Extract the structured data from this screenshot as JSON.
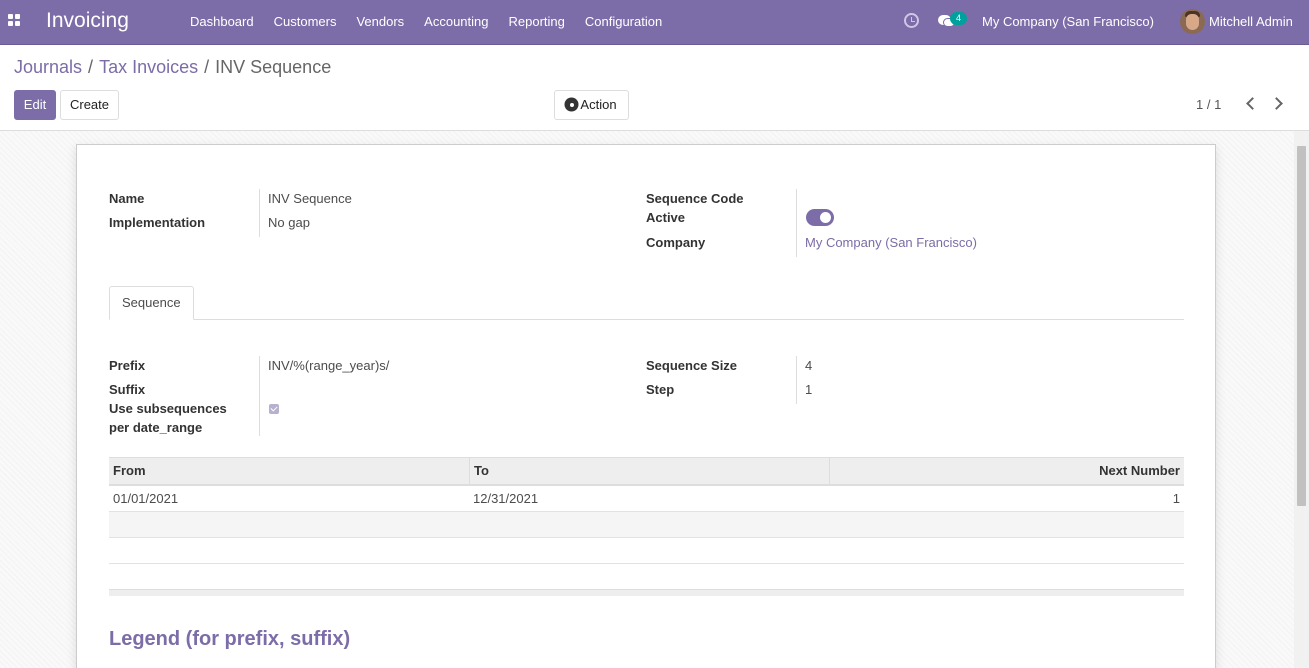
{
  "app": {
    "title": "Invoicing"
  },
  "nav": {
    "menu": [
      "Dashboard",
      "Customers",
      "Vendors",
      "Accounting",
      "Reporting",
      "Configuration"
    ],
    "messages_count": "4",
    "company": "My Company (San Francisco)",
    "user": "Mitchell Admin"
  },
  "breadcrumb": {
    "items": [
      "Journals",
      "Tax Invoices"
    ],
    "separator": "/",
    "current": "INV Sequence"
  },
  "buttons": {
    "edit": "Edit",
    "create": "Create",
    "action": "Action"
  },
  "pager": {
    "value": "1 / 1"
  },
  "form": {
    "name": {
      "label": "Name",
      "value": "INV Sequence"
    },
    "implementation": {
      "label": "Implementation",
      "value": "No gap"
    },
    "sequence_code": {
      "label": "Sequence Code",
      "value": ""
    },
    "active": {
      "label": "Active",
      "value": true
    },
    "company": {
      "label": "Company",
      "value": "My Company (San Francisco)"
    }
  },
  "tabs": [
    "Sequence"
  ],
  "sequence": {
    "prefix": {
      "label": "Prefix",
      "value": "INV/%(range_year)s/"
    },
    "suffix": {
      "label": "Suffix",
      "value": ""
    },
    "use_subsequences": {
      "label_line1": "Use subsequences",
      "label_line2": "per date_range",
      "value": true
    },
    "size": {
      "label": "Sequence Size",
      "value": "4"
    },
    "step": {
      "label": "Step",
      "value": "1"
    }
  },
  "date_ranges": {
    "columns": [
      "From",
      "To",
      "Next Number"
    ],
    "rows": [
      {
        "from": "01/01/2021",
        "to": "12/31/2021",
        "next": "1"
      }
    ]
  },
  "legend": {
    "title": "Legend (for prefix, suffix)"
  },
  "colors": {
    "brand": "#7c6ca7",
    "badge": "#00a09d"
  },
  "icons": [
    "apps-grid-icon",
    "clock-icon",
    "chat-icon",
    "gear-icon",
    "chevron-left-icon",
    "chevron-right-icon"
  ]
}
